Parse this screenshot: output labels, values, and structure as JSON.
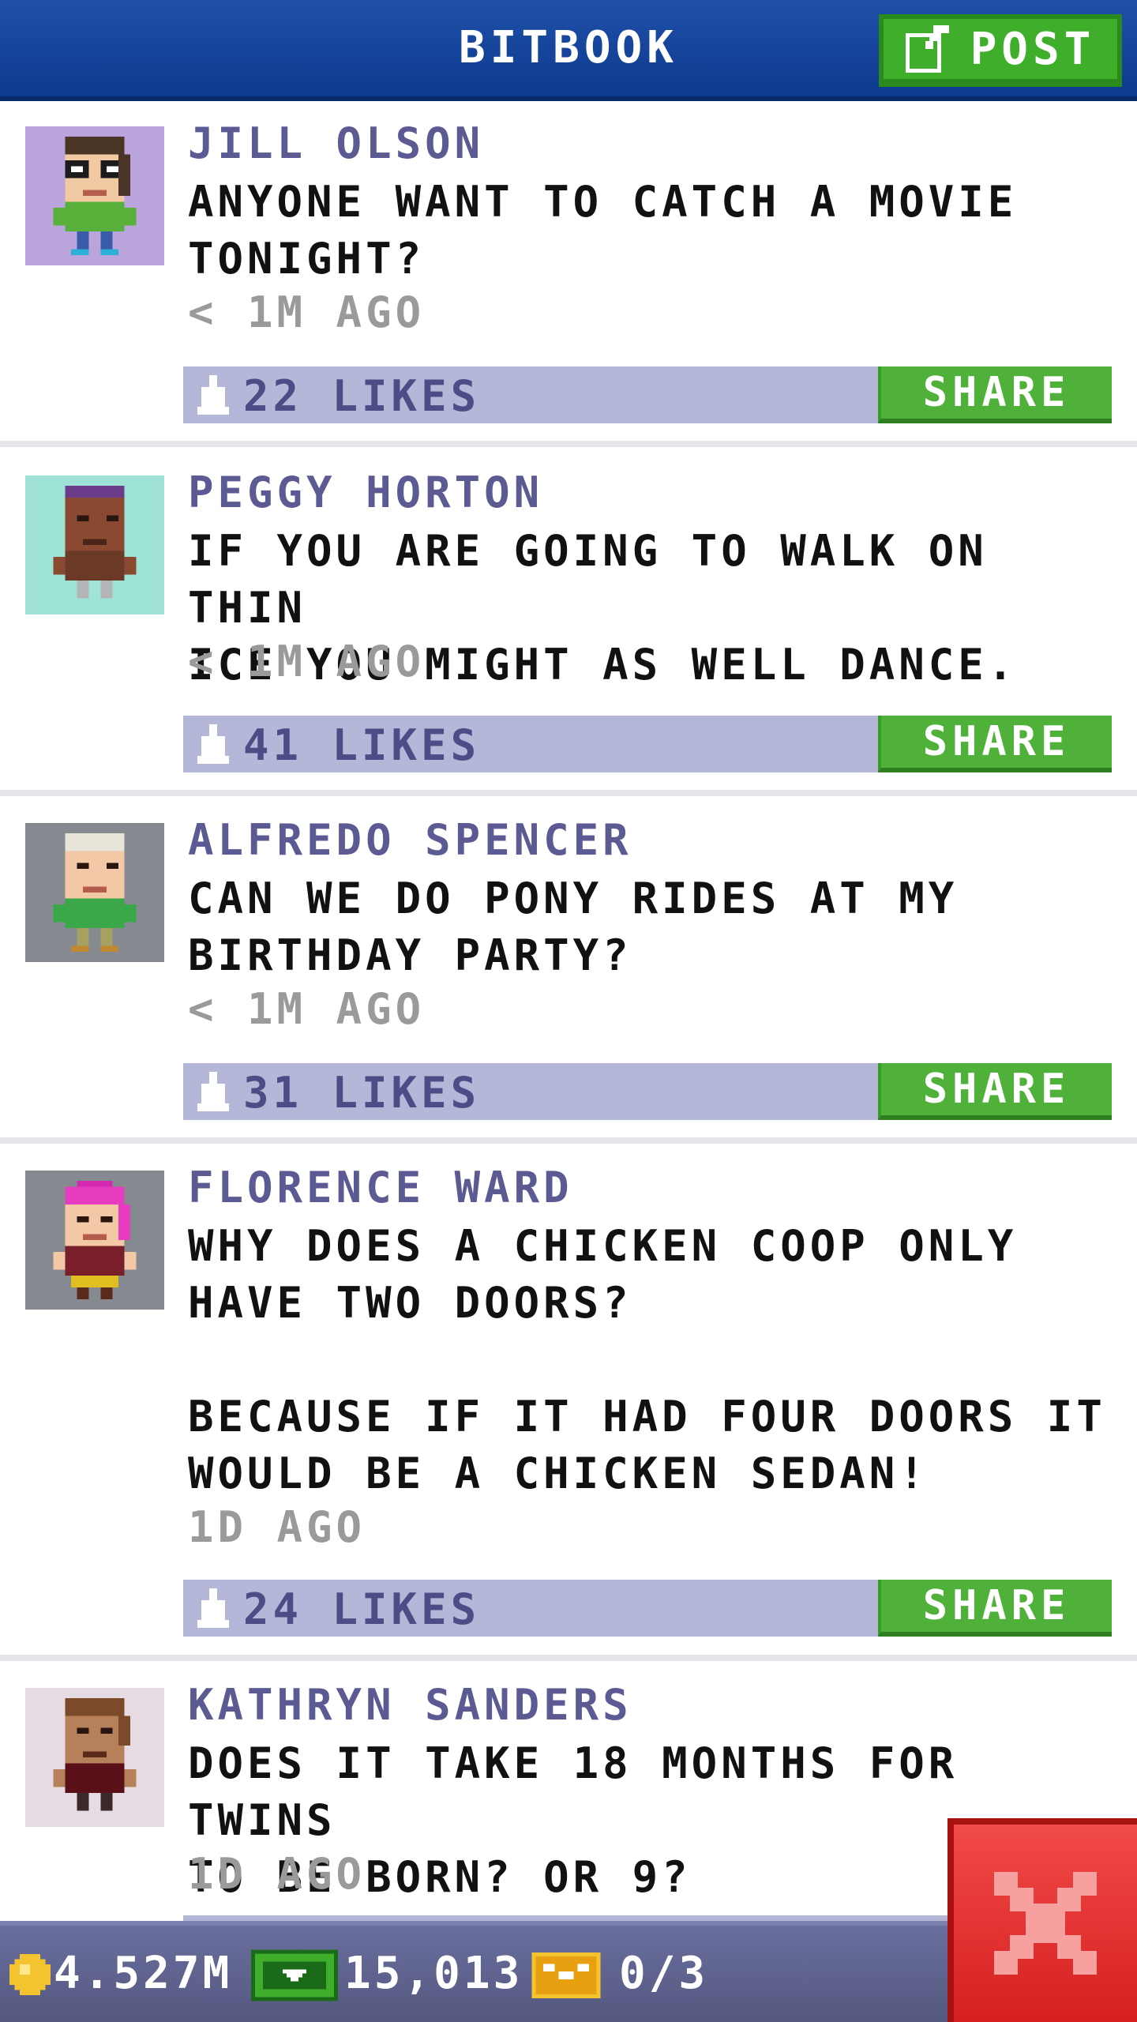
{
  "header": {
    "title": "BITBOOK",
    "post_label": "POST"
  },
  "posts": [
    {
      "author": "JILL OLSON",
      "message": "ANYONE WANT TO CATCH A MOVIE\nTONIGHT?",
      "time": "< 1M AGO",
      "likes": "22 LIKES",
      "share_label": "SHARE",
      "avatar_bg": "#b9a4dc"
    },
    {
      "author": "PEGGY HORTON",
      "message": "IF YOU ARE GOING TO WALK ON THIN\nICE YOU MIGHT AS WELL DANCE.",
      "time": "< 1M AGO",
      "likes": "41 LIKES",
      "share_label": "SHARE",
      "avatar_bg": "#9ee3d6"
    },
    {
      "author": "ALFREDO SPENCER",
      "message": "CAN WE DO PONY RIDES AT MY\nBIRTHDAY PARTY?",
      "time": "< 1M AGO",
      "likes": "31 LIKES",
      "share_label": "SHARE",
      "avatar_bg": "#858a90"
    },
    {
      "author": "FLORENCE WARD",
      "message": "WHY DOES A CHICKEN COOP ONLY\nHAVE TWO DOORS?\n\nBECAUSE IF IT HAD FOUR DOORS IT\nWOULD BE A CHICKEN SEDAN!",
      "time": "1D AGO",
      "likes": "24 LIKES",
      "share_label": "SHARE",
      "avatar_bg": "#858a90"
    },
    {
      "author": "KATHRYN SANDERS",
      "message": "DOES IT TAKE 18 MONTHS FOR TWINS\nTO BE BORN? OR 9?",
      "time": "1D AGO",
      "likes": "",
      "share_label": "",
      "avatar_bg": "#e6dbe2"
    }
  ],
  "status_bar": {
    "coins": "4.527M",
    "bux": "15,013",
    "tickets": "0/3"
  },
  "colors": {
    "header": "#0c3a8e",
    "share": "#4fb03a",
    "like_bar": "#b5b7d8",
    "close": "#e02a28"
  }
}
